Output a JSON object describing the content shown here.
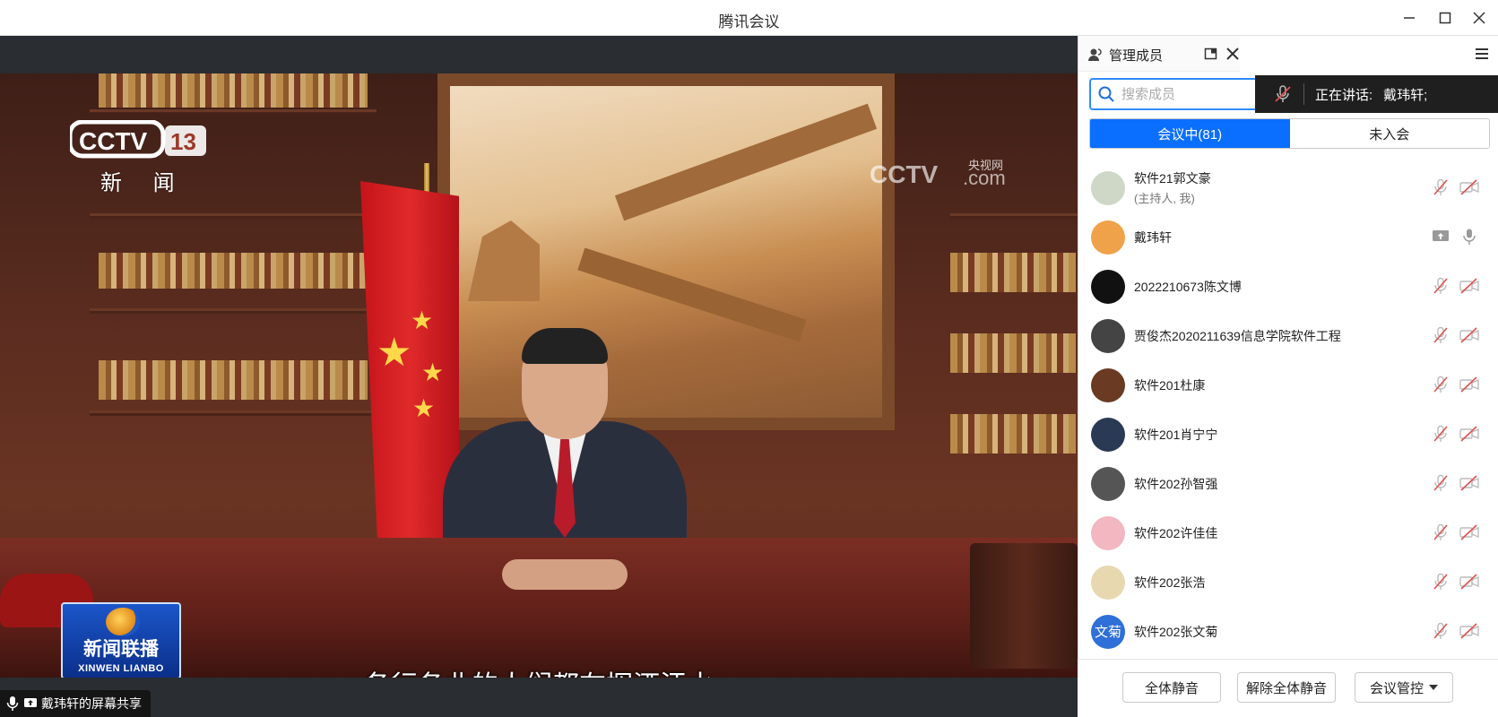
{
  "window": {
    "title": "腾讯会议"
  },
  "video": {
    "logo_channel": "新 闻",
    "watermark": "央视网",
    "program_title": "新闻联播",
    "program_sub": "XINWEN LIANBO",
    "subtitle": "各行各业的人们都在挥洒汗水",
    "share_label": "戴玮轩的屏幕共享"
  },
  "sidebar": {
    "tab_label": "管理成员",
    "search_placeholder": "搜索成员",
    "speaking_label": "正在讲话:",
    "speaking_name": "戴玮轩;",
    "seg_in_meeting": "会议中(81)",
    "seg_not_joined": "未入会",
    "members": [
      {
        "name": "软件21郭文豪",
        "sub": "(主持人, 我)",
        "avatar_color": "#cfd8c6",
        "avatar_text": "",
        "mic": "muted",
        "cam": "off"
      },
      {
        "name": "戴玮轩",
        "sub": "",
        "avatar_color": "#f0a24a",
        "avatar_text": "",
        "mic": "on",
        "cam": "share"
      },
      {
        "name": "2022210673陈文博",
        "sub": "",
        "avatar_color": "#111111",
        "avatar_text": "",
        "mic": "muted",
        "cam": "off"
      },
      {
        "name": "贾俊杰2020211639信息学院软件工程",
        "sub": "",
        "avatar_color": "#444444",
        "avatar_text": "",
        "mic": "muted",
        "cam": "off"
      },
      {
        "name": "软件201杜康",
        "sub": "",
        "avatar_color": "#6b3a22",
        "avatar_text": "",
        "mic": "muted",
        "cam": "off"
      },
      {
        "name": "软件201肖宁宁",
        "sub": "",
        "avatar_color": "#2a3a55",
        "avatar_text": "",
        "mic": "muted",
        "cam": "off"
      },
      {
        "name": "软件202孙智强",
        "sub": "",
        "avatar_color": "#555555",
        "avatar_text": "",
        "mic": "muted",
        "cam": "off"
      },
      {
        "name": "软件202许佳佳",
        "sub": "",
        "avatar_color": "#f2b7c0",
        "avatar_text": "",
        "mic": "muted",
        "cam": "off"
      },
      {
        "name": "软件202张浩",
        "sub": "",
        "avatar_color": "#e8d8b0",
        "avatar_text": "",
        "mic": "muted",
        "cam": "off"
      },
      {
        "name": "软件202张文菊",
        "sub": "",
        "avatar_color": "#2f6fd8",
        "avatar_text": "文菊",
        "mic": "muted",
        "cam": "off"
      }
    ]
  },
  "bottom": {
    "mute_all": "全体静音",
    "unmute_all": "解除全体静音",
    "control": "会议管控"
  },
  "colors": {
    "accent": "#0a6fff",
    "muted_red": "#e0514f"
  }
}
